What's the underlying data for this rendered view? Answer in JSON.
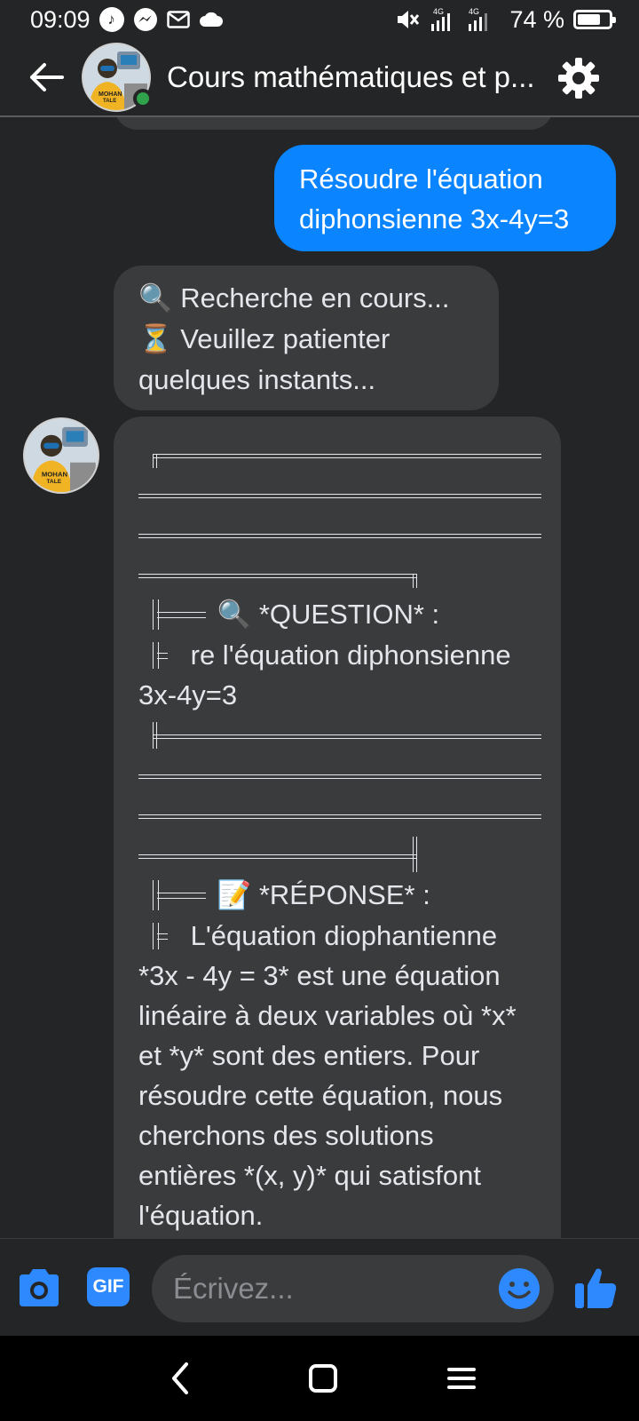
{
  "status_bar": {
    "time": "09:09",
    "battery_text": "74 %",
    "battery_level": 0.74,
    "network_label_1": "4G",
    "network_label_2": "4G"
  },
  "header": {
    "title": "Cours mathématiques et p...",
    "avatar_name": "MOHAN TALE",
    "online": true
  },
  "messages": {
    "outgoing": {
      "line1": "Résoudre l'équation",
      "line2": "diphonsienne 3x-4y=3"
    },
    "status": {
      "line1": "Recherche en cours...",
      "line2": "Veuillez patienter",
      "line3": "quelques instants..."
    },
    "answer": {
      "question_label": "*QUESTION* :",
      "question_text_1": "re l'équation diphonsienne",
      "question_text_2": "3x-4y=3",
      "response_label": "*RÉPONSE* :",
      "response_first": "L'équation diophantienne",
      "response_body": "*3x - 4y = 3* est une équation linéaire à deux variables où *x* et *y* sont des entiers. Pour résoudre cette équation, nous cherchons des solutions entières *(x, y)* qui satisfont l'équation."
    }
  },
  "composer": {
    "placeholder": "Écrivez...",
    "gif_label": "GIF"
  },
  "colors": {
    "background": "#242526",
    "bubble_incoming": "#3a3b3c",
    "bubble_outgoing": "#0a84ff",
    "accent": "#2e89ff",
    "online": "#31a24c"
  },
  "icons": {
    "status": [
      "tiktok-icon",
      "messenger-icon",
      "mail-icon",
      "cloud-icon",
      "mute-icon",
      "signal-icon",
      "battery-icon"
    ],
    "header": [
      "back-arrow-icon",
      "gear-icon"
    ],
    "composer": [
      "camera-icon",
      "gif-icon",
      "emoji-icon",
      "thumbs-up-icon"
    ],
    "nav": [
      "nav-back-icon",
      "nav-home-icon",
      "nav-menu-icon"
    ]
  }
}
